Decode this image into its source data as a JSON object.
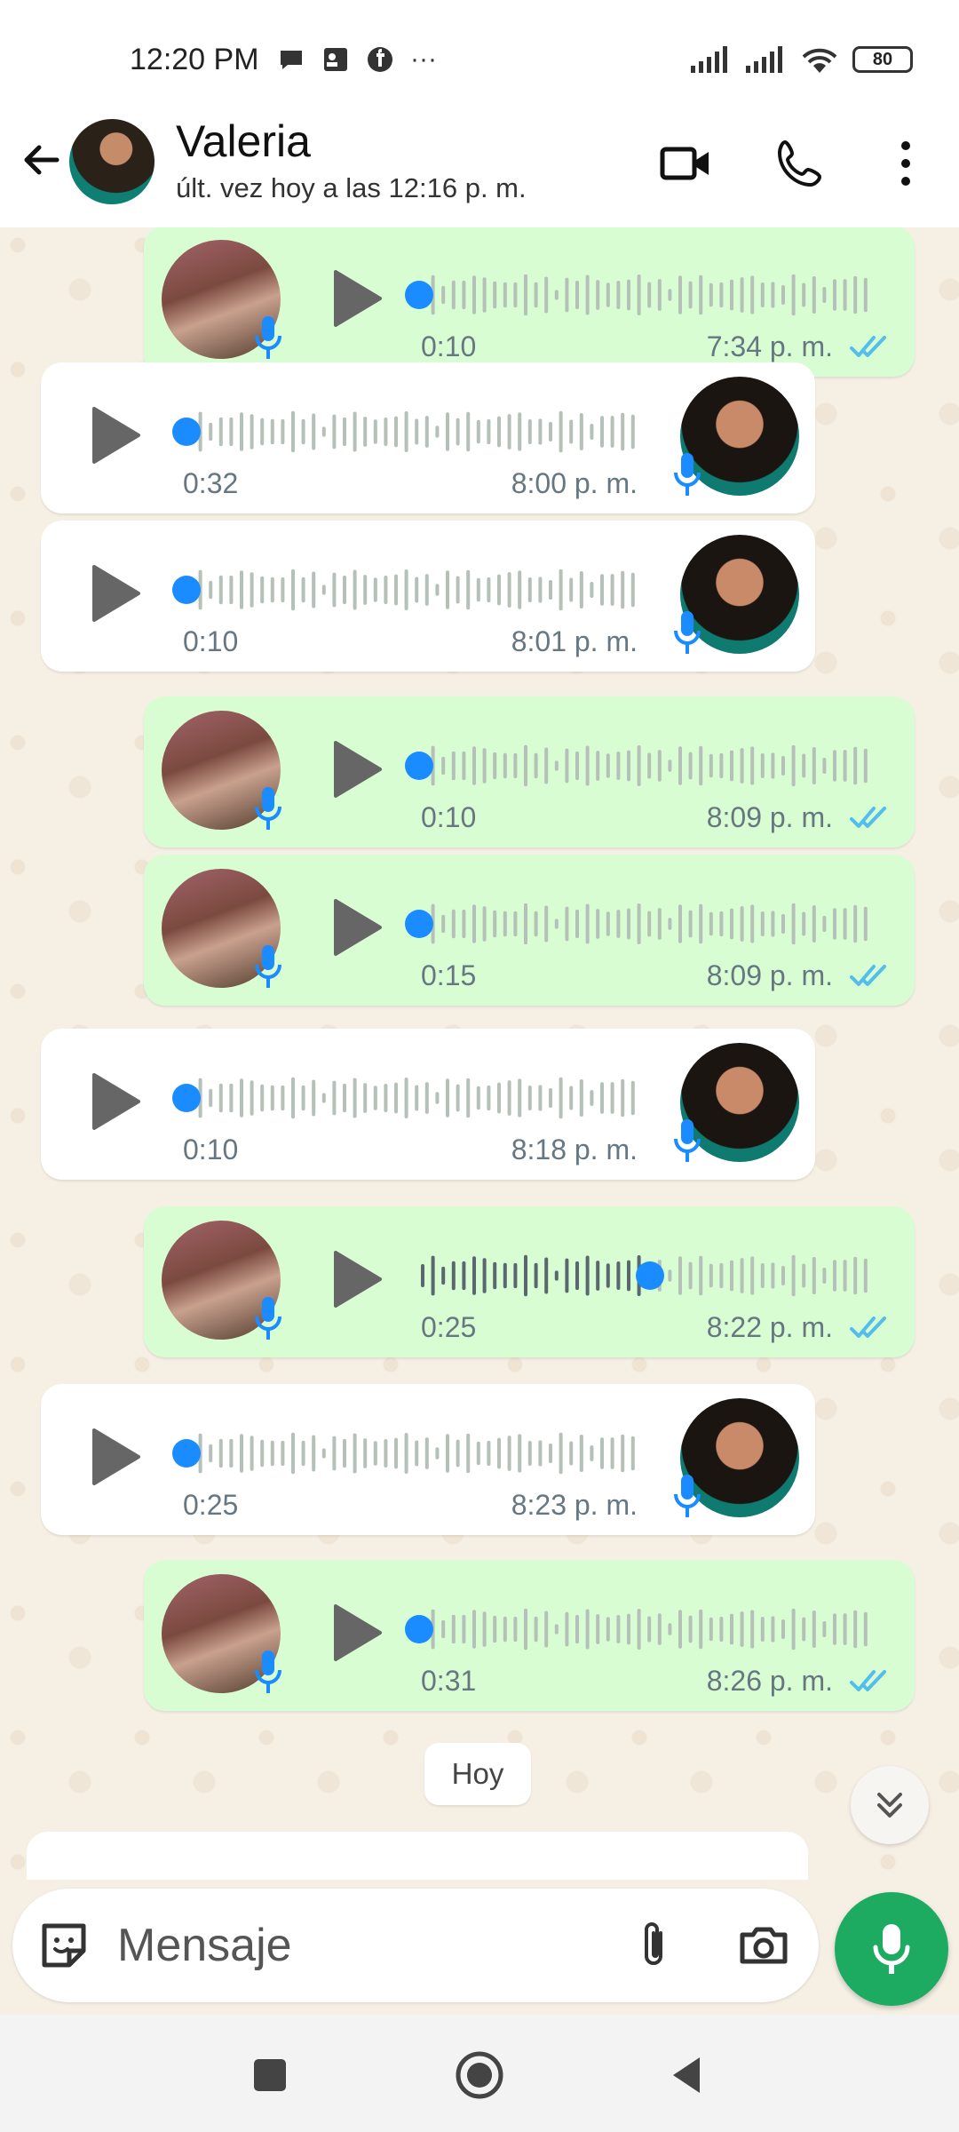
{
  "status_bar": {
    "time": "12:20 PM",
    "notifications": [
      "chat-bubble-icon",
      "contact-card-icon",
      "facebook-icon",
      "more-dots"
    ],
    "more": "···",
    "battery": "80"
  },
  "header": {
    "contact_name": "Valeria",
    "last_seen": "últ. vez hoy a las 12:16 p. m."
  },
  "messages": [
    {
      "direction": "out",
      "duration": "0:10",
      "time": "7:34 p. m.",
      "progress": 0
    },
    {
      "direction": "in",
      "duration": "0:32",
      "time": "8:00 p. m.",
      "progress": 0
    },
    {
      "direction": "in",
      "duration": "0:10",
      "time": "8:01 p. m.",
      "progress": 0
    },
    {
      "direction": "out",
      "duration": "0:10",
      "time": "8:09 p. m.",
      "progress": 0
    },
    {
      "direction": "out",
      "duration": "0:15",
      "time": "8:09 p. m.",
      "progress": 0
    },
    {
      "direction": "in",
      "duration": "0:10",
      "time": "8:18 p. m.",
      "progress": 0
    },
    {
      "direction": "out",
      "duration": "0:25",
      "time": "8:22 p. m.",
      "progress": 0.5
    },
    {
      "direction": "in",
      "duration": "0:25",
      "time": "8:23 p. m.",
      "progress": 0
    },
    {
      "direction": "out",
      "duration": "0:31",
      "time": "8:26 p. m.",
      "progress": 0
    }
  ],
  "date_separator": "Hoy",
  "composer": {
    "placeholder": "Mensaje"
  },
  "colors": {
    "outgoing_bubble": "#d9fdd3",
    "incoming_bubble": "#ffffff",
    "accent_blue": "#1a8cff",
    "mic_button": "#1daa61",
    "read_ticks": "#53bdeb"
  }
}
